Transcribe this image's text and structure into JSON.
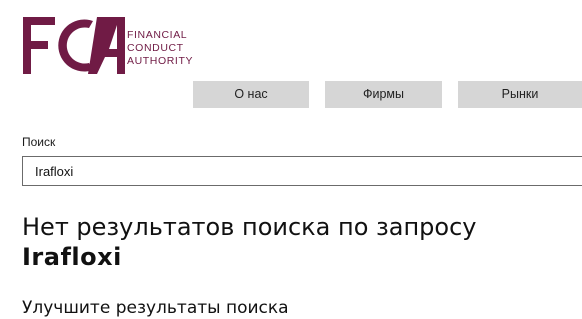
{
  "brand": {
    "logo_letters": "FCA",
    "name_lines": [
      "FINANCIAL",
      "CONDUCT",
      "AUTHORITY"
    ],
    "color": "#701b45"
  },
  "nav": {
    "items": [
      {
        "label": "О нас"
      },
      {
        "label": "Фирмы"
      },
      {
        "label": "Рынки"
      }
    ],
    "background": "#d6d6d6"
  },
  "search": {
    "label": "Поиск",
    "value": "Irafloxi"
  },
  "results": {
    "heading": "Нет результатов поиска по запросу",
    "query": "Irafloxi",
    "subheading": "Улучшите результаты поиска"
  }
}
